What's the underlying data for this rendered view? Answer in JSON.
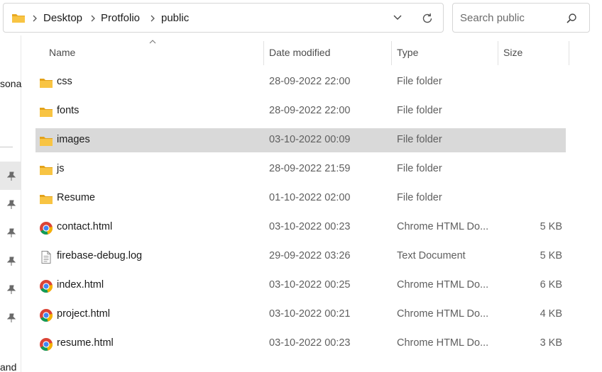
{
  "address": {
    "breadcrumb": [
      "Desktop",
      "Protfolio",
      "public"
    ]
  },
  "search": {
    "placeholder": "Search public"
  },
  "nav": {
    "partial_label_top": "sona",
    "partial_label_bottom": "and"
  },
  "columns": {
    "name": "Name",
    "date": "Date modified",
    "type": "Type",
    "size": "Size"
  },
  "files": [
    {
      "name": "css",
      "date": "28-09-2022 22:00",
      "type": "File folder",
      "size": "",
      "icon": "folder-icon"
    },
    {
      "name": "fonts",
      "date": "28-09-2022 22:00",
      "type": "File folder",
      "size": "",
      "icon": "folder-icon"
    },
    {
      "name": "images",
      "date": "03-10-2022 00:09",
      "type": "File folder",
      "size": "",
      "icon": "folder-icon",
      "selected": true
    },
    {
      "name": "js",
      "date": "28-09-2022 21:59",
      "type": "File folder",
      "size": "",
      "icon": "folder-icon"
    },
    {
      "name": "Resume",
      "date": "01-10-2022 02:00",
      "type": "File folder",
      "size": "",
      "icon": "folder-icon"
    },
    {
      "name": "contact.html",
      "date": "03-10-2022 00:23",
      "type": "Chrome HTML Do...",
      "size": "5 KB",
      "icon": "chrome-icon"
    },
    {
      "name": "firebase-debug.log",
      "date": "29-09-2022 03:26",
      "type": "Text Document",
      "size": "5 KB",
      "icon": "text-file-icon"
    },
    {
      "name": "index.html",
      "date": "03-10-2022 00:25",
      "type": "Chrome HTML Do...",
      "size": "6 KB",
      "icon": "chrome-icon"
    },
    {
      "name": "project.html",
      "date": "03-10-2022 00:21",
      "type": "Chrome HTML Do...",
      "size": "4 KB",
      "icon": "chrome-icon"
    },
    {
      "name": "resume.html",
      "date": "03-10-2022 00:23",
      "type": "Chrome HTML Do...",
      "size": "3 KB",
      "icon": "chrome-icon"
    }
  ],
  "colors": {
    "selection": "#d9d9d9",
    "folder": "#f8c443",
    "chrome_red": "#db4437",
    "chrome_green": "#0f9d58",
    "chrome_yellow": "#f4b400",
    "chrome_blue": "#4285f4"
  }
}
